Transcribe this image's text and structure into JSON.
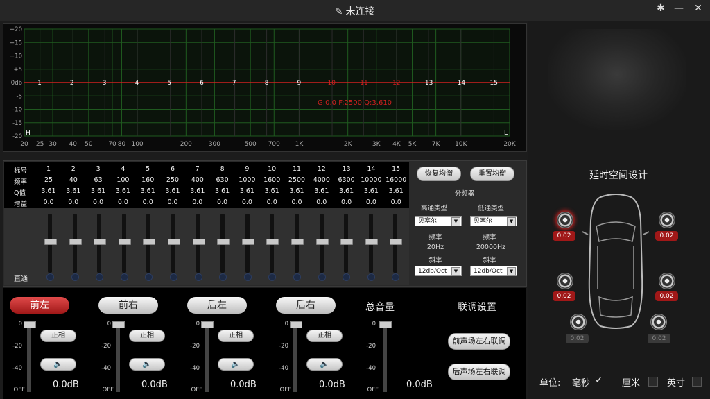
{
  "window": {
    "title": "未连接"
  },
  "graph": {
    "y_labels": [
      "+20",
      "+15",
      "+10",
      "+5",
      "0db",
      "-5",
      "-10",
      "-15",
      "-20"
    ],
    "x_labels": [
      "20",
      "25",
      "30",
      "40",
      "50",
      "70",
      "80",
      "100",
      "200",
      "300",
      "500",
      "700",
      "1K",
      "2K",
      "3K",
      "4K",
      "5K",
      "7K",
      "10K",
      "20K"
    ],
    "band_markers": [
      "1",
      "2",
      "3",
      "4",
      "5",
      "6",
      "7",
      "8",
      "9",
      "10",
      "11",
      "12",
      "13",
      "14",
      "15"
    ],
    "low_marker": "H",
    "high_marker": "L",
    "status": "G:0.0  F:2500  Q:3.610"
  },
  "eq_table": {
    "row_labels": [
      "标号",
      "频率",
      "Q值",
      "增益"
    ],
    "bands": [
      {
        "id": "1",
        "freq": "25",
        "q": "3.61",
        "gain": "0.0"
      },
      {
        "id": "2",
        "freq": "40",
        "q": "3.61",
        "gain": "0.0"
      },
      {
        "id": "3",
        "freq": "63",
        "q": "3.61",
        "gain": "0.0"
      },
      {
        "id": "4",
        "freq": "100",
        "q": "3.61",
        "gain": "0.0"
      },
      {
        "id": "5",
        "freq": "160",
        "q": "3.61",
        "gain": "0.0"
      },
      {
        "id": "6",
        "freq": "250",
        "q": "3.61",
        "gain": "0.0"
      },
      {
        "id": "7",
        "freq": "400",
        "q": "3.61",
        "gain": "0.0"
      },
      {
        "id": "8",
        "freq": "630",
        "q": "3.61",
        "gain": "0.0"
      },
      {
        "id": "9",
        "freq": "1000",
        "q": "3.61",
        "gain": "0.0"
      },
      {
        "id": "10",
        "freq": "1600",
        "q": "3.61",
        "gain": "0.0"
      },
      {
        "id": "11",
        "freq": "2500",
        "q": "3.61",
        "gain": "0.0"
      },
      {
        "id": "12",
        "freq": "4000",
        "q": "3.61",
        "gain": "0.0"
      },
      {
        "id": "13",
        "freq": "6300",
        "q": "3.61",
        "gain": "0.0"
      },
      {
        "id": "14",
        "freq": "10000",
        "q": "3.61",
        "gain": "0.0"
      },
      {
        "id": "15",
        "freq": "16000",
        "q": "3.61",
        "gain": "0.0"
      }
    ],
    "bypass_label": "直通"
  },
  "crossover": {
    "restore_eq": "恢复均衡",
    "reset_eq": "重置均衡",
    "title": "分频器",
    "hp_type_label": "高通类型",
    "lp_type_label": "低通类型",
    "hp_type_value": "贝塞尔",
    "lp_type_value": "贝塞尔",
    "freq_label": "频率",
    "hp_freq": "20Hz",
    "lp_freq": "20000Hz",
    "slope_label": "斜率",
    "hp_slope": "12db/Oct",
    "lp_slope": "12db/Oct"
  },
  "delay": {
    "title": "延时空间设计",
    "front_left": "0.02",
    "front_right": "0.02",
    "mid_left": "0.02",
    "mid_right": "0.02",
    "rear_left": "0.02",
    "rear_right": "0.02",
    "unit_label": "单位:",
    "unit_ms": "毫秒",
    "unit_cm": "厘米",
    "unit_inch": "英寸"
  },
  "channels": [
    {
      "label": "前左",
      "phase": "正相",
      "db": "0.0dB"
    },
    {
      "label": "前右",
      "phase": "正相",
      "db": "0.0dB"
    },
    {
      "label": "后左",
      "phase": "正相",
      "db": "0.0dB"
    },
    {
      "label": "后右",
      "phase": "正相",
      "db": "0.0dB"
    }
  ],
  "scale": {
    "top": "0",
    "mid1": "-20",
    "mid2": "-40",
    "bottom": "OFF"
  },
  "master": {
    "label": "总音量",
    "db": "0.0dB"
  },
  "link": {
    "title": "联调设置",
    "front": "前声场左右联调",
    "rear": "后声场左右联调"
  },
  "colors": {
    "accent_red": "#c42020",
    "grid_green": "#1f5a1f",
    "curve_red": "#d02020"
  },
  "icons": {
    "plug": "plug-icon",
    "gear": "gear-icon",
    "minimize": "minimize-icon",
    "close": "close-icon",
    "speaker": "speaker-icon",
    "check": "check-icon"
  }
}
